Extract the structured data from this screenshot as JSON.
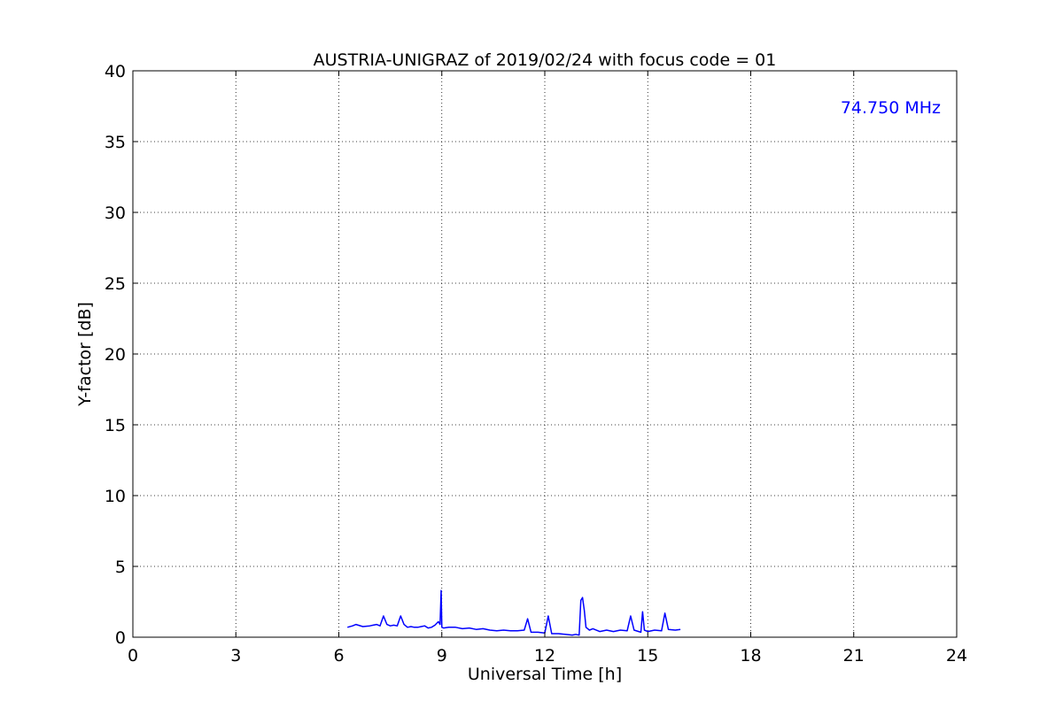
{
  "chart_data": {
    "type": "line",
    "title": "AUSTRIA-UNIGRAZ of 2019/02/24 with focus code = 01",
    "xlabel": "Universal Time [h]",
    "ylabel": "Y-factor [dB]",
    "xlim": [
      0,
      24
    ],
    "ylim": [
      0,
      40
    ],
    "xticks": [
      0,
      3,
      6,
      9,
      12,
      15,
      18,
      21,
      24
    ],
    "yticks": [
      0,
      5,
      10,
      15,
      20,
      25,
      30,
      35,
      40
    ],
    "x_tick_labels": [
      "0",
      "3",
      "6",
      "9",
      "12",
      "15",
      "18",
      "21",
      "24"
    ],
    "y_tick_labels": [
      "0",
      "5",
      "10",
      "15",
      "20",
      "25",
      "30",
      "35",
      "40"
    ],
    "grid": true,
    "annotation": {
      "text": "74.750 MHz",
      "color": "#0000ff",
      "placement": "top-right"
    },
    "series": [
      {
        "color": "#0000ff",
        "x": [
          6.25,
          6.4,
          6.5,
          6.7,
          6.9,
          7.0,
          7.1,
          7.2,
          7.3,
          7.4,
          7.5,
          7.6,
          7.7,
          7.8,
          7.9,
          8.0,
          8.1,
          8.2,
          8.3,
          8.4,
          8.5,
          8.6,
          8.7,
          8.8,
          8.9,
          8.95,
          8.98,
          9.0,
          9.05,
          9.2,
          9.4,
          9.6,
          9.8,
          10.0,
          10.2,
          10.4,
          10.6,
          10.8,
          11.0,
          11.2,
          11.4,
          11.5,
          11.6,
          11.8,
          12.0,
          12.1,
          12.2,
          12.4,
          12.6,
          12.8,
          12.9,
          13.0,
          13.05,
          13.1,
          13.15,
          13.2,
          13.3,
          13.4,
          13.6,
          13.8,
          14.0,
          14.2,
          14.4,
          14.5,
          14.6,
          14.8,
          14.85,
          14.9,
          15.0,
          15.2,
          15.4,
          15.5,
          15.6,
          15.8,
          15.95
        ],
        "y": [
          0.7,
          0.8,
          0.9,
          0.75,
          0.8,
          0.85,
          0.9,
          0.8,
          1.5,
          0.9,
          0.8,
          0.85,
          0.8,
          1.5,
          0.9,
          0.7,
          0.75,
          0.7,
          0.7,
          0.75,
          0.8,
          0.65,
          0.7,
          0.85,
          1.1,
          0.9,
          3.3,
          0.7,
          0.65,
          0.7,
          0.7,
          0.6,
          0.65,
          0.55,
          0.6,
          0.5,
          0.45,
          0.5,
          0.45,
          0.45,
          0.5,
          1.3,
          0.35,
          0.35,
          0.3,
          1.5,
          0.25,
          0.25,
          0.2,
          0.15,
          0.2,
          0.15,
          2.6,
          2.8,
          1.9,
          0.7,
          0.5,
          0.6,
          0.4,
          0.5,
          0.4,
          0.5,
          0.45,
          1.5,
          0.5,
          0.35,
          1.8,
          0.5,
          0.4,
          0.5,
          0.45,
          1.7,
          0.55,
          0.5,
          0.55
        ]
      }
    ]
  }
}
